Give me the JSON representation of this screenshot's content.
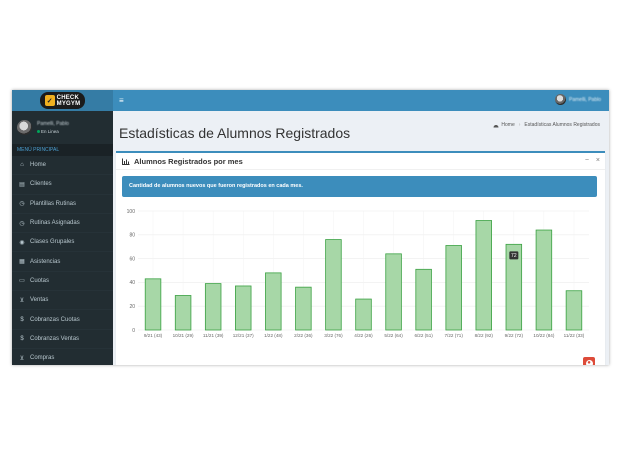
{
  "logo": {
    "line1": "CHECK",
    "line2": "MYGYM"
  },
  "user": {
    "name": "Pamelli, Pablo",
    "status": "En Linea"
  },
  "sidebar": {
    "menu_header": "MENÚ PRINCIPAL",
    "items": [
      {
        "label": "Home",
        "icon": "home-icon",
        "glyph": "⌂"
      },
      {
        "label": "Clientes",
        "icon": "contacts-icon",
        "glyph": "▤"
      },
      {
        "label": "Plantillas Rutinas",
        "icon": "clock-icon",
        "glyph": "◷"
      },
      {
        "label": "Rutinas Asignadas",
        "icon": "clock-icon",
        "glyph": "◷"
      },
      {
        "label": "Clases Grupales",
        "icon": "group-icon",
        "glyph": "◉"
      },
      {
        "label": "Asistencias",
        "icon": "calendar-icon",
        "glyph": "▦"
      },
      {
        "label": "Cuotas",
        "icon": "card-icon",
        "glyph": "▭"
      },
      {
        "label": "Ventas",
        "icon": "cart-icon",
        "glyph": "⊻"
      },
      {
        "label": "Cobranzas Cuotas",
        "icon": "dollar-icon",
        "glyph": "$"
      },
      {
        "label": "Cobranzas Ventas",
        "icon": "dollar-icon",
        "glyph": "$"
      },
      {
        "label": "Compras",
        "icon": "cart-icon",
        "glyph": "⊻"
      }
    ]
  },
  "header": {
    "menu_icon": "≡",
    "user_name": "Pamelli, Pablo"
  },
  "content": {
    "title": "Estadísticas de Alumnos Registrados",
    "breadcrumb": {
      "home": "Home",
      "current": "Estadísticas Alumnos Registrados"
    }
  },
  "box": {
    "title": "Alumnos Registrados por mes",
    "collapse": "−",
    "close": "×",
    "callout": "Cantidad de alumnos nuevos que fueron registrados en cada mes."
  },
  "colors": {
    "bar_fill": "#a7d7a7",
    "bar_stroke": "#3aa142",
    "accent": "#3c8dbc",
    "danger": "#dd4b39"
  },
  "chart_data": {
    "type": "bar",
    "categories": [
      "9/21 (43)",
      "10/21 (29)",
      "11/21 (39)",
      "12/21 (37)",
      "1/22 (48)",
      "2/22 (36)",
      "3/22 (76)",
      "4/22 (26)",
      "5/22 (64)",
      "6/22 (51)",
      "7/22 (71)",
      "8/22 (92)",
      "9/22 (72)",
      "10/22 (84)",
      "11/22 (33)"
    ],
    "values": [
      43,
      29,
      39,
      37,
      48,
      36,
      76,
      26,
      64,
      51,
      71,
      92,
      72,
      84,
      33
    ],
    "y_ticks": [
      "0",
      "20",
      "40",
      "60",
      "80",
      "100"
    ],
    "ylim": [
      0,
      100
    ],
    "grid": true,
    "tooltip": {
      "category_index": 12,
      "text": "72"
    }
  }
}
